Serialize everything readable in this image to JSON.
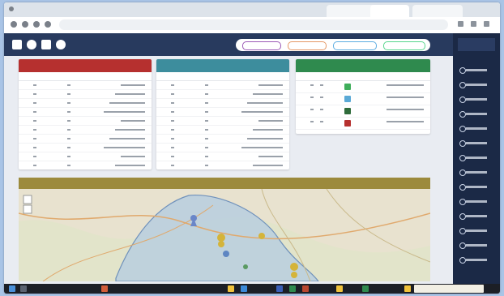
{
  "browser": {
    "tabs": [
      {
        "title": "",
        "active": false
      },
      {
        "title": "",
        "active": true
      },
      {
        "title": "",
        "active": false
      }
    ],
    "url": ""
  },
  "app": {
    "title": "",
    "filter_chips": [
      {
        "label": "",
        "color": "#9b59b6"
      },
      {
        "label": "",
        "color": "#e59866"
      },
      {
        "label": "",
        "color": "#5dade2"
      },
      {
        "label": "",
        "color": "#58d68d"
      }
    ],
    "sidebar": {
      "items": [
        {
          "label": "",
          "icon": "home-icon"
        },
        {
          "label": "",
          "icon": "list-icon"
        },
        {
          "label": "",
          "icon": "map-icon"
        },
        {
          "label": "",
          "icon": "chart-icon"
        },
        {
          "label": "",
          "icon": "users-icon"
        },
        {
          "label": "",
          "icon": "settings-icon"
        },
        {
          "label": "",
          "icon": "file-icon"
        },
        {
          "label": "",
          "icon": "bell-icon"
        },
        {
          "label": "",
          "icon": "calendar-icon"
        },
        {
          "label": "",
          "icon": "archive-icon"
        },
        {
          "label": "",
          "icon": "tag-icon"
        },
        {
          "label": "",
          "icon": "phone-icon"
        },
        {
          "label": "",
          "icon": "help-icon"
        },
        {
          "label": "",
          "icon": "logout-icon"
        }
      ]
    },
    "cards": [
      {
        "id": "red",
        "title": "",
        "color": "#b6302f",
        "columns": [
          "",
          "",
          ""
        ],
        "rows": 10
      },
      {
        "id": "teal",
        "title": "",
        "color": "#3d8d9d",
        "columns": [
          "",
          "",
          ""
        ],
        "rows": 10
      },
      {
        "id": "green",
        "title": "",
        "color": "#2f8a4e",
        "columns": [
          "",
          "",
          ""
        ],
        "rows": 4,
        "swatches": [
          "#3fae5b",
          "#5aa9d6",
          "#2e6b3a",
          "#b6302f"
        ]
      }
    ],
    "map_panel": {
      "title": "",
      "header_color": "#9c8a3c"
    }
  },
  "taskbar": {
    "notification": ""
  }
}
